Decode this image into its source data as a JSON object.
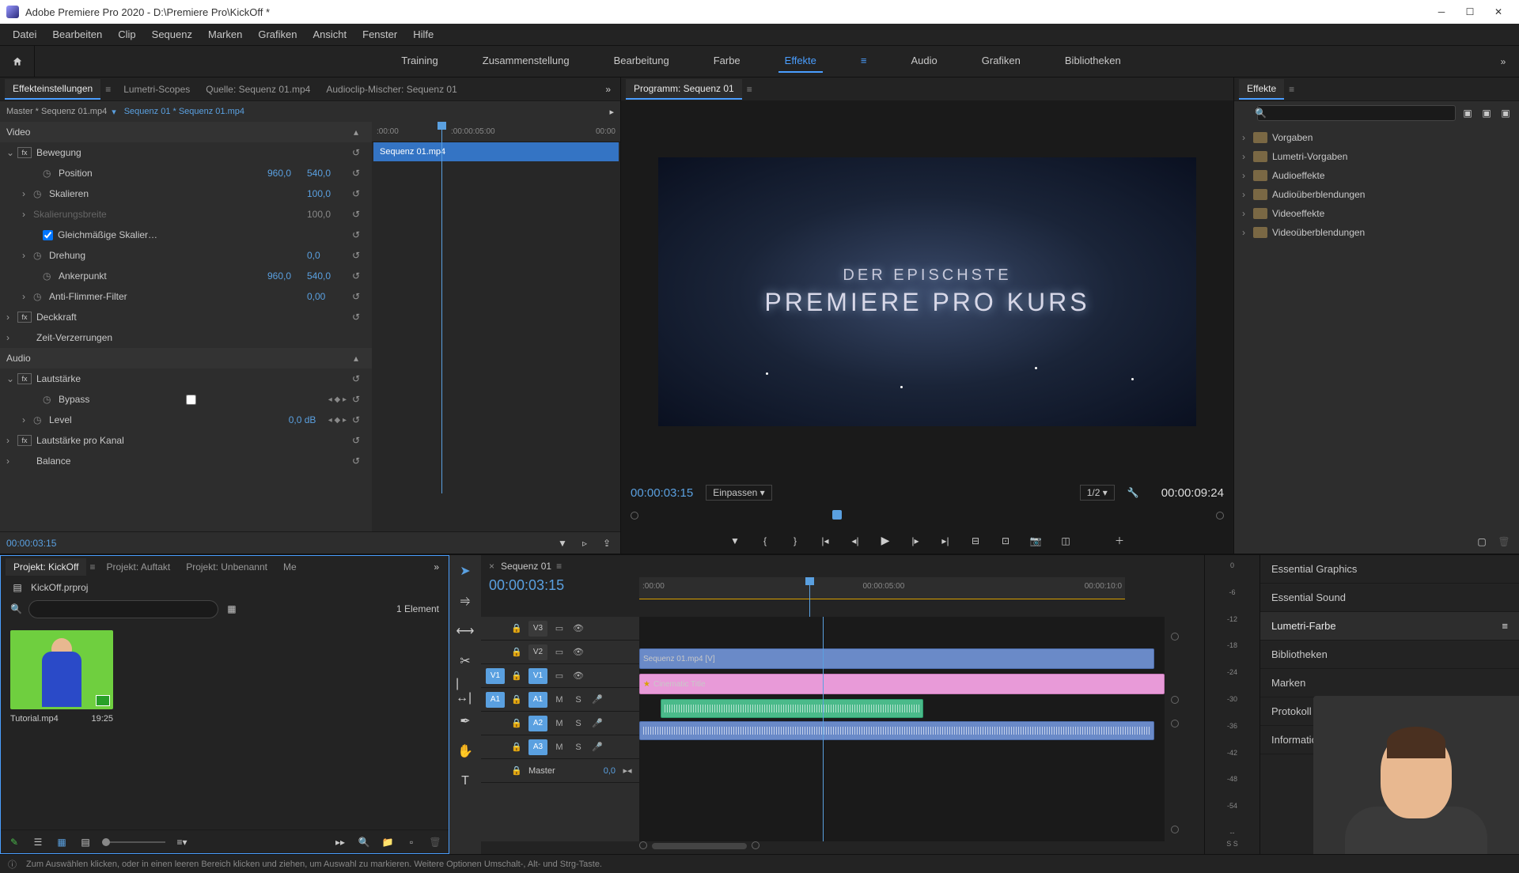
{
  "titlebar": {
    "text": "Adobe Premiere Pro 2020 - D:\\Premiere Pro\\KickOff *"
  },
  "menubar": [
    "Datei",
    "Bearbeiten",
    "Clip",
    "Sequenz",
    "Marken",
    "Grafiken",
    "Ansicht",
    "Fenster",
    "Hilfe"
  ],
  "workspaces": [
    "Training",
    "Zusammenstellung",
    "Bearbeitung",
    "Farbe",
    "Effekte",
    "Audio",
    "Grafiken",
    "Bibliotheken"
  ],
  "workspace_active": "Effekte",
  "sourceTabs": [
    "Effekteinstellungen",
    "Lumetri-Scopes",
    "Quelle: Sequenz 01.mp4",
    "Audioclip-Mischer: Sequenz 01"
  ],
  "ec": {
    "master": "Master * Sequenz 01.mp4",
    "seq": "Sequenz 01 * Sequenz 01.mp4",
    "clipTitle": "Sequenz 01.mp4",
    "videoSection": "Video",
    "motion": "Bewegung",
    "position": "Position",
    "positionX": "960,0",
    "positionY": "540,0",
    "scale": "Skalieren",
    "scaleVal": "100,0",
    "scaleWidth": "Skalierungsbreite",
    "scaleWidthVal": "100,0",
    "uniform": "Gleichmäßige Skalier…",
    "rotation": "Drehung",
    "rotationVal": "0,0",
    "anchor": "Ankerpunkt",
    "anchorX": "960,0",
    "anchorY": "540,0",
    "antiFlicker": "Anti-Flimmer-Filter",
    "antiFlickerVal": "0,00",
    "opacity": "Deckkraft",
    "timeRemap": "Zeit-Verzerrungen",
    "audioSection": "Audio",
    "volume": "Lautstärke",
    "bypass": "Bypass",
    "level": "Level",
    "levelVal": "0,0 dB",
    "channelVol": "Lautstärke pro Kanal",
    "balance": "Balance",
    "timecode": "00:00:03:15",
    "rulerMarks": [
      ":00:00",
      ":00:00:05:00",
      "00:00"
    ]
  },
  "program": {
    "tab": "Programm: Sequenz 01",
    "title_line1": "DER EPISCHSTE",
    "title_line2": "PREMIERE PRO KURS",
    "tc_left": "00:00:03:15",
    "fit": "Einpassen",
    "zoom": "1/2",
    "tc_right": "00:00:09:24"
  },
  "effects": {
    "tab": "Effekte",
    "folders": [
      "Vorgaben",
      "Lumetri-Vorgaben",
      "Audioeffekte",
      "Audioüberblendungen",
      "Videoeffekte",
      "Videoüberblendungen"
    ]
  },
  "project": {
    "tabs": [
      "Projekt: KickOff",
      "Projekt: Auftakt",
      "Projekt: Unbenannt",
      "Me"
    ],
    "filename": "KickOff.prproj",
    "count": "1 Element",
    "item_name": "Tutorial.mp4",
    "item_dur": "19:25"
  },
  "timeline": {
    "seq": "Sequenz 01",
    "tc": "00:00:03:15",
    "ruler": [
      ":00:00",
      "00:00:05:00",
      "00:00:10:0"
    ],
    "tracks_v": [
      "V3",
      "V2",
      "V1"
    ],
    "tracks_a": [
      "A1",
      "A2",
      "A3"
    ],
    "master": "Master",
    "masterVal": "0,0",
    "clip_video": "Sequenz 01.mp4 [V]",
    "clip_graphic": "Cinematic Title"
  },
  "meters": [
    "0",
    "-6",
    "-12",
    "-18",
    "-24",
    "-30",
    "-36",
    "-42",
    "-48",
    "-54",
    "--"
  ],
  "meters_footer": "S   S",
  "rightStack": [
    "Essential Graphics",
    "Essential Sound",
    "Lumetri-Farbe",
    "Bibliotheken",
    "Marken",
    "Protokoll",
    "Informationen"
  ],
  "rightStack_active": "Lumetri-Farbe",
  "status": "Zum Auswählen klicken, oder in einen leeren Bereich klicken und ziehen, um Auswahl zu markieren. Weitere Optionen Umschalt-, Alt- und Strg-Taste."
}
